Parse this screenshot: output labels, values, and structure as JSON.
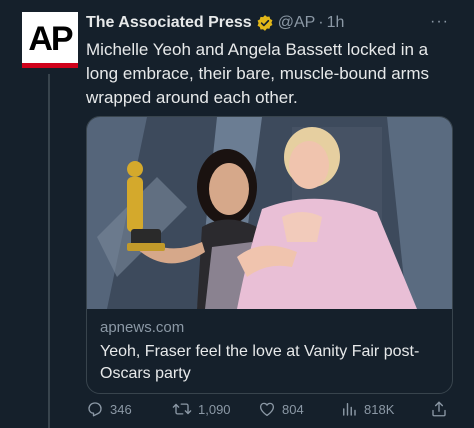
{
  "author": {
    "avatar_text": "AP",
    "display_name": "The Associated Press",
    "handle": "@AP",
    "separator": "·",
    "time": "1h",
    "verified_badge": "gold-verified-icon"
  },
  "more_label": "···",
  "tweet_text": "Michelle Yeoh and Angela Bassett locked in a long embrace, their bare, muscle-bound arms wrapped around each other.",
  "card": {
    "domain": "apnews.com",
    "title": "Yeoh, Fraser feel the love at Vanity Fair post-Oscars party"
  },
  "actions": {
    "replies": "346",
    "retweets": "1,090",
    "likes": "804",
    "views": "818K"
  },
  "colors": {
    "background": "#15202b",
    "text_primary": "#e7e9ea",
    "text_secondary": "#8b98a5",
    "verified_gold": "#e2b719",
    "ap_red": "#d0021b"
  }
}
